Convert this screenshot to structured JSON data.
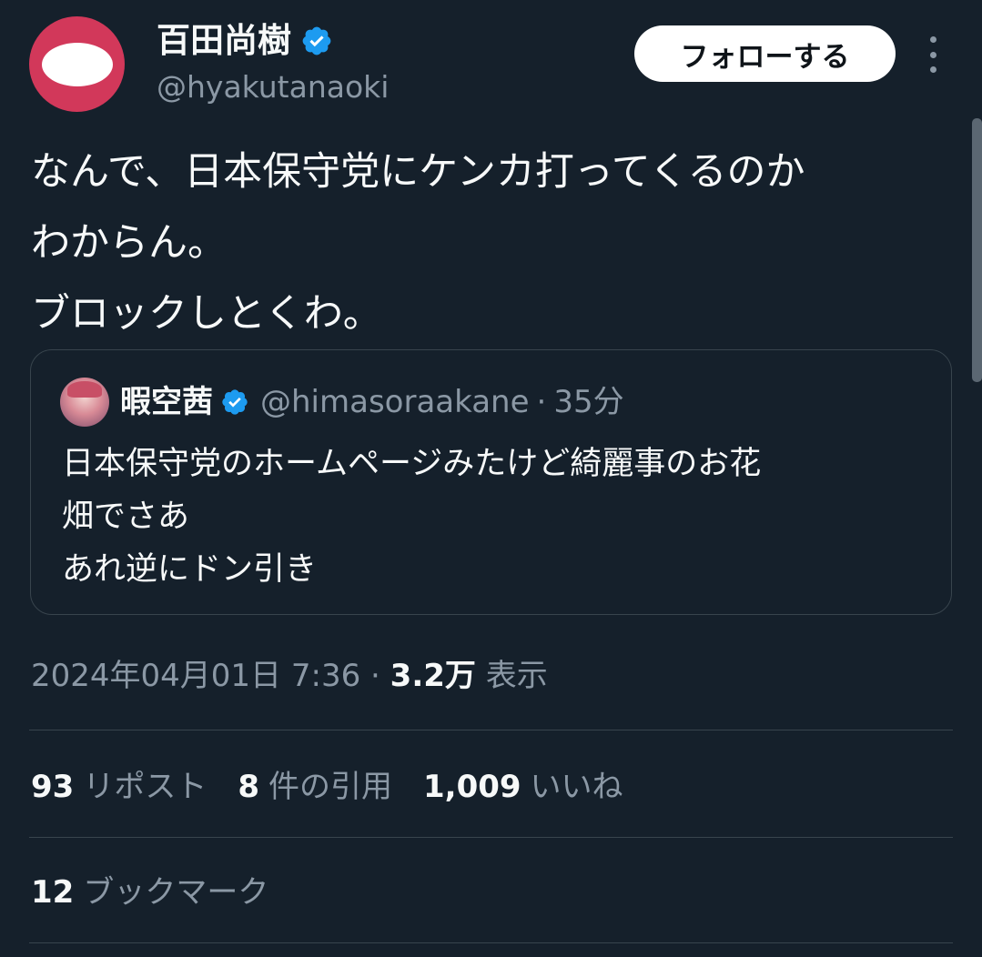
{
  "author": {
    "name": "百田尚樹",
    "handle": "@hyakutanaoki",
    "avatar_colors": {
      "ring": "#d2385a",
      "inner": "#ffffff"
    }
  },
  "follow_label": "フォローする",
  "tweet_text": "なんで、日本保守党にケンカ打ってくるのか\nわからん。\nブロックしとくわ。",
  "quote": {
    "name": "暇空茜",
    "handle": "@himasoraakane",
    "separator": "·",
    "time": "35分",
    "text": "日本保守党のホームページみたけど綺麗事のお花\n畑でさあ\nあれ逆にドン引き"
  },
  "meta": {
    "datetime": "2024年04月01日 7:36",
    "separator": "·",
    "views_count": "3.2万",
    "views_label": "表示"
  },
  "stats": {
    "reposts_count": "93",
    "reposts_label": "リポスト",
    "quotes_count": "8",
    "quotes_label": "件の引用",
    "likes_count": "1,009",
    "likes_label": "いいね"
  },
  "bookmarks": {
    "count": "12",
    "label": "ブックマーク"
  },
  "colors": {
    "background": "#15202b",
    "text": "#f7f9f9",
    "secondary": "#8b98a5",
    "border": "#38444d",
    "verified": "#1d9bf0"
  }
}
